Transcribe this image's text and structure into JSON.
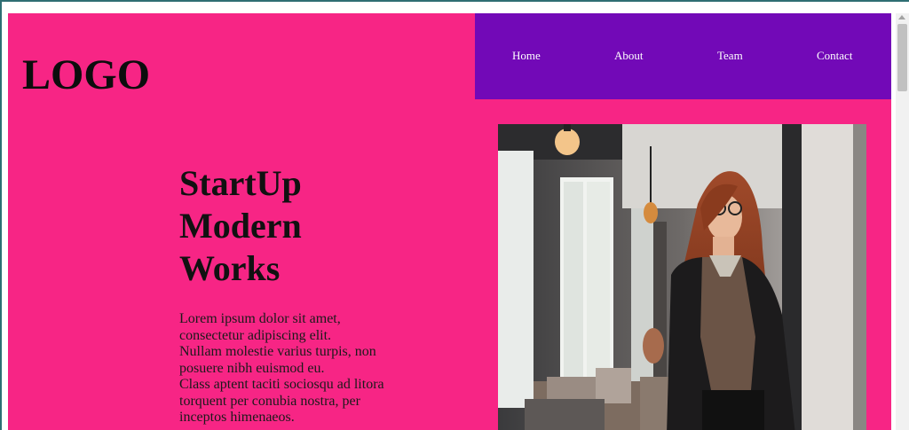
{
  "header": {
    "logo_text": "LOGO"
  },
  "nav": {
    "items": [
      {
        "label": "Home"
      },
      {
        "label": "About"
      },
      {
        "label": "Team"
      },
      {
        "label": "Contact"
      }
    ]
  },
  "hero": {
    "title_lines": [
      "StartUp",
      "Modern",
      "Works"
    ],
    "text_lines": [
      "Lorem ipsum dolor sit amet,",
      "consectetur adipiscing elit.",
      "Nullam molestie varius turpis, non",
      "posuere nibh euismod eu.",
      "Class aptent taciti sociosqu ad litora",
      "torquent per conubia nostra, per",
      "inceptos himenaeos."
    ]
  },
  "colors": {
    "page_background": "#f72585",
    "nav_background": "#7209b7",
    "nav_text": "#ffffff"
  }
}
